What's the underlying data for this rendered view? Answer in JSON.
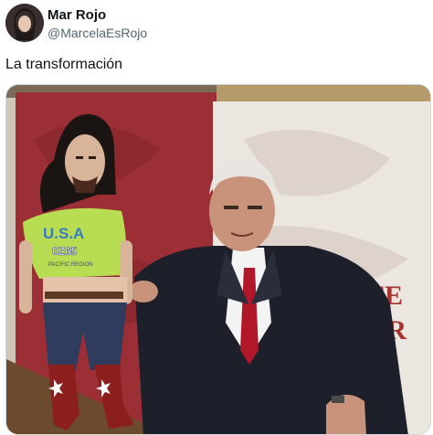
{
  "tweet": {
    "display_name": "Mar Rojo",
    "handle": "@MarcelaEsRojo",
    "text": "La transformación"
  },
  "media": {
    "shirt_text_top": "U.S.A",
    "shirt_text_mid": "0Z65",
    "shirt_text_bottom": "PACIFIC REGION",
    "backdrop_text_1": "IFE",
    "backdrop_text_2": "PR"
  },
  "colors": {
    "backdrop_red": "#9c2f36",
    "backdrop_white": "#ece6e1",
    "shirt_green": "#b8dc52",
    "suit": "#1d1f2a",
    "tie": "#b0182a"
  }
}
